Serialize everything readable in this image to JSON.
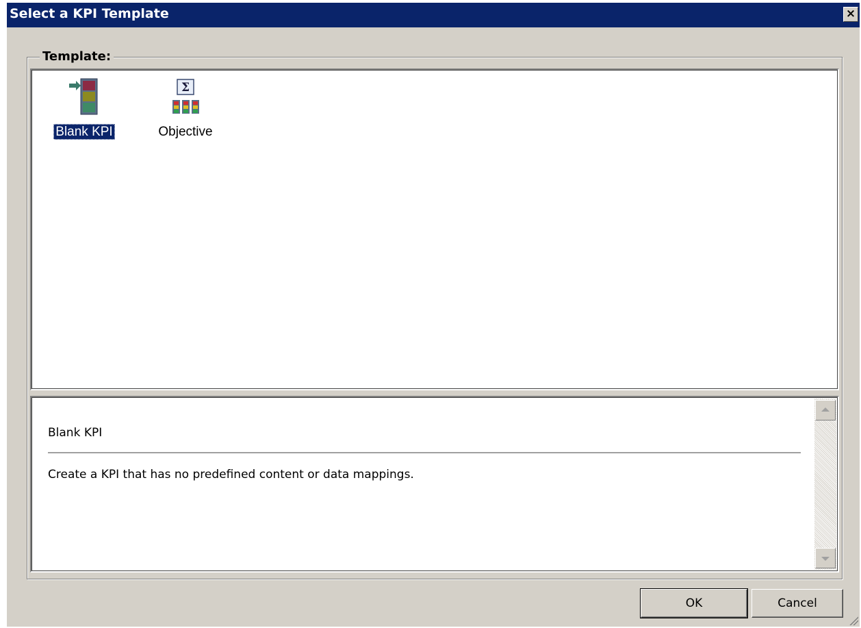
{
  "window": {
    "title": "Select a KPI Template",
    "close_label": "×"
  },
  "group": {
    "label": "Template:"
  },
  "templates": [
    {
      "label": "Blank KPI",
      "selected": true,
      "icon": "blank-kpi-icon"
    },
    {
      "label": "Objective",
      "selected": false,
      "icon": "objective-sigma-icon"
    }
  ],
  "description": {
    "title": "Blank KPI",
    "body": "Create a KPI that has no predefined content or data mappings."
  },
  "buttons": {
    "ok": "OK",
    "cancel": "Cancel"
  },
  "colors": {
    "titlebar": "#0a246a",
    "face": "#d4d0c8",
    "selection": "#0a246a"
  }
}
